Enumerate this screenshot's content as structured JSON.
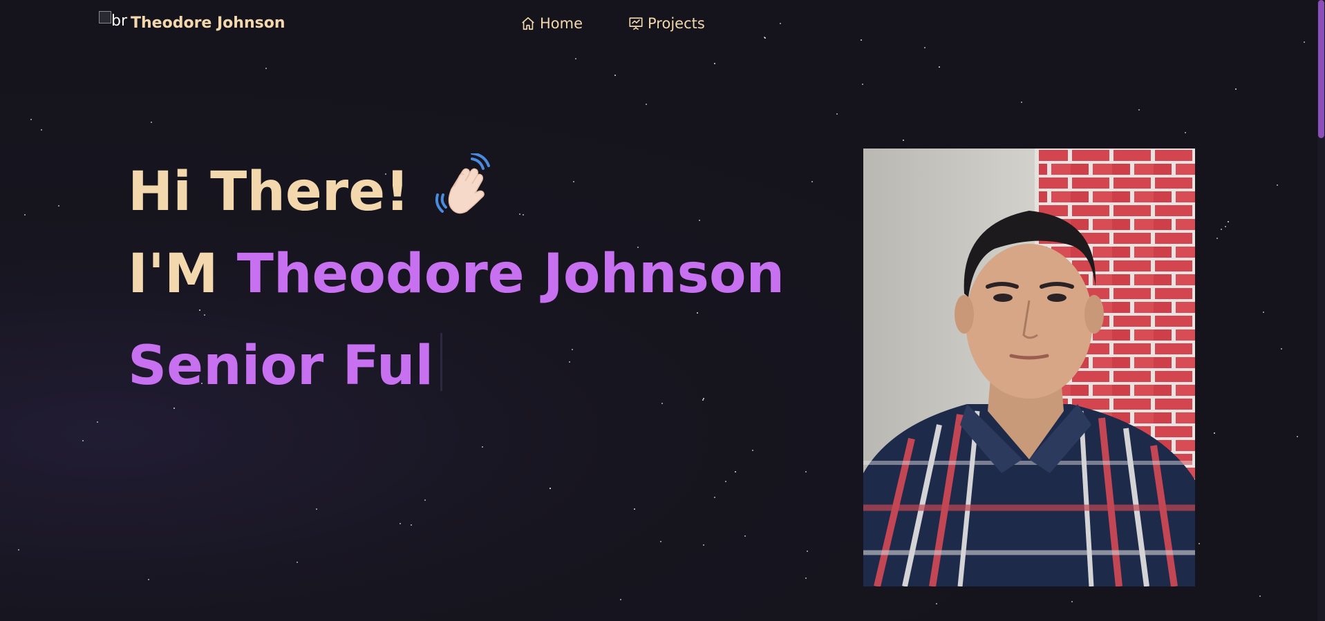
{
  "navbar": {
    "brand_image_alt": "br",
    "brand_name": "Theodore Johnson",
    "links": [
      {
        "label": "Home",
        "icon": "home-icon"
      },
      {
        "label": "Projects",
        "icon": "presentation-icon"
      }
    ]
  },
  "hero": {
    "greeting": "Hi There!",
    "greeting_emoji": "waving-hand-icon",
    "intro_prefix": "I'M",
    "name": "Theodore Johnson",
    "typed_text": "Senior Ful"
  },
  "photo": {
    "subject": "profile-photo"
  },
  "colors": {
    "background": "#15141c",
    "accent_cream": "#f3d8ad",
    "accent_purple": "#c770f0",
    "scroll_thumb": "#8a4fb8"
  }
}
